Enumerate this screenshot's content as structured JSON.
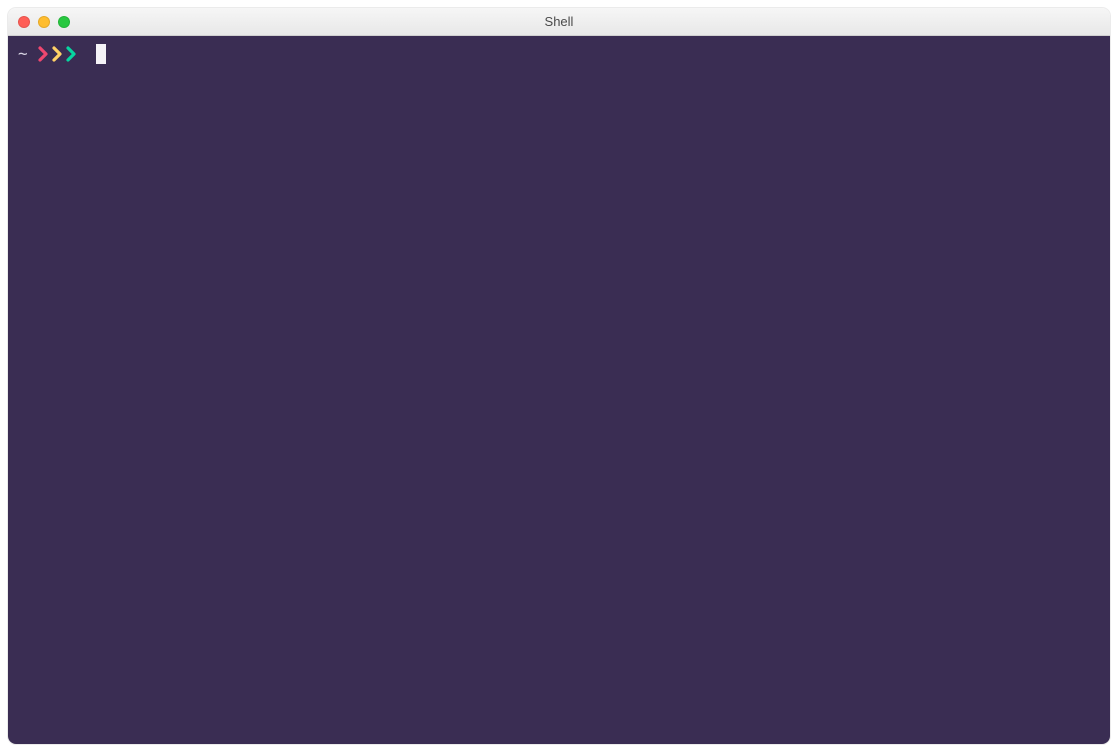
{
  "window": {
    "title": "Shell"
  },
  "terminal": {
    "background": "#3a2d53",
    "prompt": {
      "cwd": "~",
      "chevrons": [
        {
          "name": "chevron-1",
          "color": "#ef476f"
        },
        {
          "name": "chevron-2",
          "color": "#ffd166"
        },
        {
          "name": "chevron-3",
          "color": "#06d6a0"
        }
      ],
      "input_value": ""
    },
    "cursor_color": "#f5f3f7"
  },
  "traffic_lights": {
    "close_color": "#ff5f57",
    "minimize_color": "#ffbd2e",
    "maximize_color": "#28c840"
  }
}
